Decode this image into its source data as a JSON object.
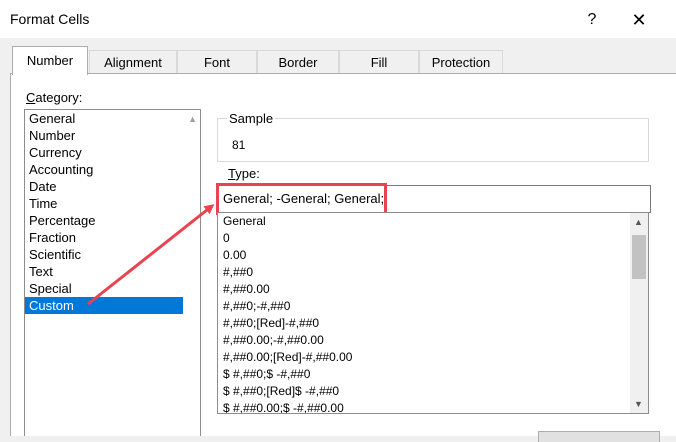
{
  "window": {
    "title": "Format Cells",
    "help_glyph": "?",
    "close_glyph": "✕"
  },
  "tabs": [
    {
      "label": "Number",
      "active": true
    },
    {
      "label": "Alignment",
      "active": false
    },
    {
      "label": "Font",
      "active": false
    },
    {
      "label": "Border",
      "active": false
    },
    {
      "label": "Fill",
      "active": false
    },
    {
      "label": "Protection",
      "active": false
    }
  ],
  "category": {
    "label_first": "C",
    "label_rest": "ategory:",
    "items": [
      "General",
      "Number",
      "Currency",
      "Accounting",
      "Date",
      "Time",
      "Percentage",
      "Fraction",
      "Scientific",
      "Text",
      "Special",
      "Custom"
    ],
    "selected": "Custom"
  },
  "sample": {
    "label": "Sample",
    "value": "81"
  },
  "type": {
    "label_first": "T",
    "label_rest": "ype:",
    "value": "General; -General; General;"
  },
  "format_list": [
    "General",
    "0",
    "0.00",
    "#,##0",
    "#,##0.00",
    "#,##0;-#,##0",
    "#,##0;[Red]-#,##0",
    "#,##0.00;-#,##0.00",
    "#,##0.00;[Red]-#,##0.00",
    "$ #,##0;$ -#,##0",
    "$ #,##0;[Red]$ -#,##0",
    "$ #,##0.00;$ -#,##0.00"
  ],
  "colors": {
    "selection": "#0078d7",
    "annotation": "#e8434f"
  }
}
